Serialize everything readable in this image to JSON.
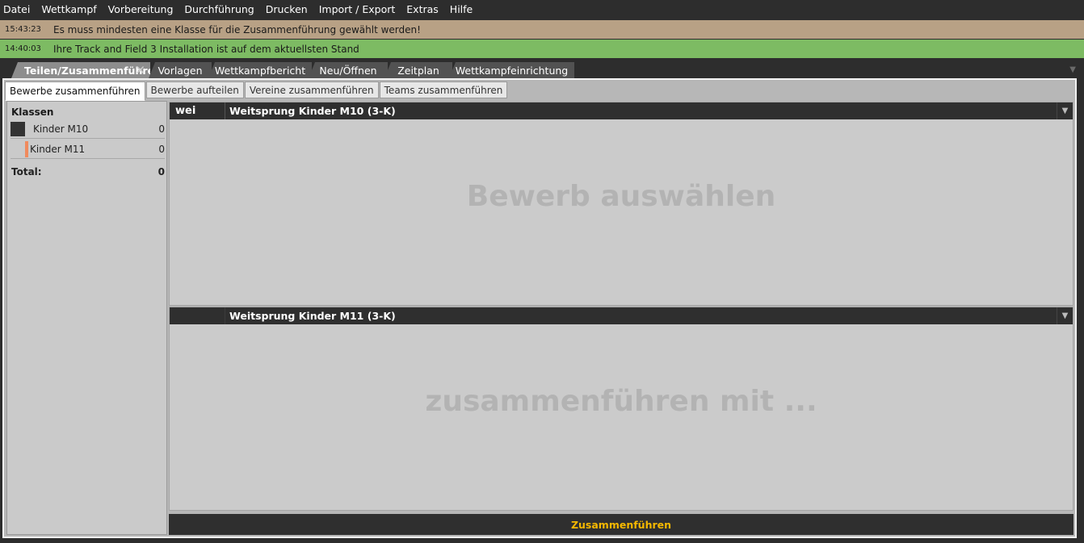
{
  "menu": [
    "Datei",
    "Wettkampf",
    "Vorbereitung",
    "Durchführung",
    "Drucken",
    "Import / Export",
    "Extras",
    "Hilfe"
  ],
  "messages": [
    {
      "time": "15:43:23",
      "text": "Es muss mindesten eine Klasse für die Zusammenführung gewählt werden!",
      "color": "#b8a185"
    },
    {
      "time": "14:40:03",
      "text": "Ihre Track and Field 3 Installation ist auf dem aktuellsten Stand",
      "color": "#7dbb63"
    }
  ],
  "tabs": [
    "Teilen/Zusammenführen",
    "Vorlagen",
    "Wettkampfbericht",
    "Neu/Öffnen",
    "Zeitplan",
    "Wettkampfeinrichtung"
  ],
  "active_tab": "Teilen/Zusammenführen",
  "subtabs": [
    "Bewerbe zusammenführen",
    "Bewerbe aufteilen",
    "Vereine zusammenführen",
    "Teams zusammenführen"
  ],
  "active_subtab": "Bewerbe zusammenführen",
  "classes_panel": {
    "title": "Klassen",
    "items": [
      {
        "name": "Kinder M10",
        "count": "0",
        "color": "#333333"
      },
      {
        "name": "Kinder M11",
        "count": "0",
        "color": "#f08a5d"
      }
    ],
    "total_label": "Total:",
    "total_value": "0"
  },
  "source_section": {
    "search_value": "wei",
    "title": "Weitsprung Kinder M10 (3-K)",
    "placeholder": "Bewerb auswählen"
  },
  "target_section": {
    "search_value": "",
    "title": "Weitsprung Kinder M11 (3-K)",
    "placeholder": "zusammenführen mit ..."
  },
  "merge_button": "Zusammenführen",
  "accent_color": "#f5b800"
}
